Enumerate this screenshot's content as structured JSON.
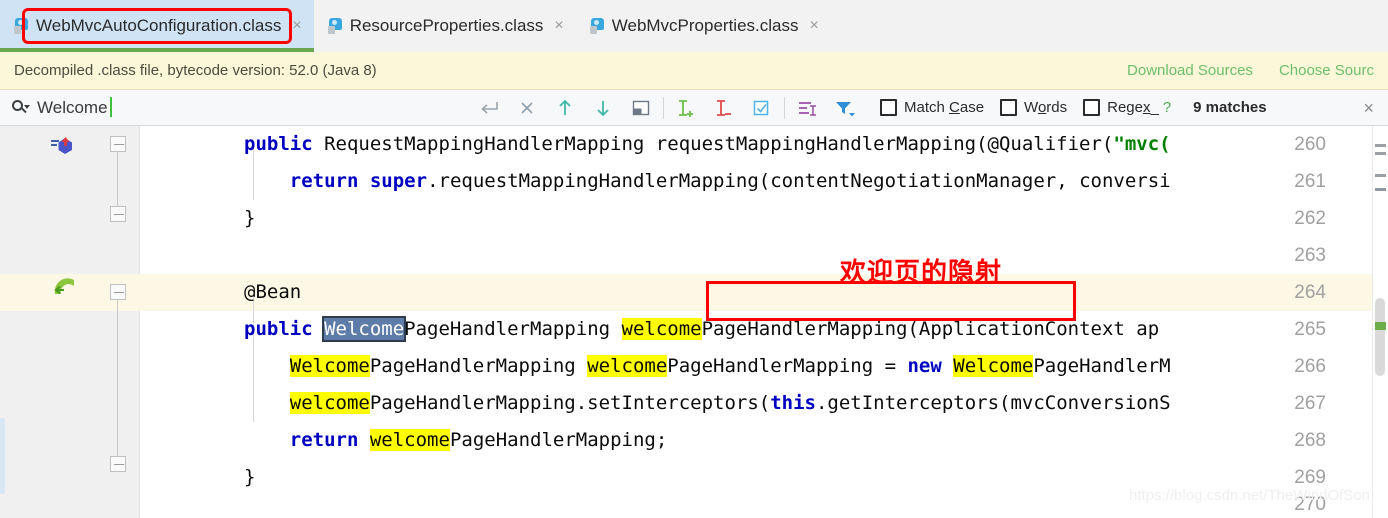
{
  "window": {
    "accent_green": "#6aa84f",
    "highlight_red": "#ff0000",
    "tab_active_bg": "#cfe3f5",
    "search_match_bg": "#ffff00"
  },
  "tabs": [
    {
      "label": "WebMvcAutoConfiguration.class",
      "icon": "java-class-icon",
      "close": "×",
      "active": true
    },
    {
      "label": "ResourceProperties.class",
      "icon": "java-class-icon",
      "close": "×",
      "active": false
    },
    {
      "label": "WebMvcProperties.class",
      "icon": "java-class-icon",
      "close": "×",
      "active": false
    }
  ],
  "notification": {
    "message": "Decompiled .class file, bytecode version: 52.0 (Java 8)",
    "download_sources": "Download Sources",
    "choose_sources": "Choose Sourc"
  },
  "search": {
    "icon": "search-icon",
    "value": "Welcome",
    "placeholder": "Search",
    "buttons": [
      {
        "name": "enter-icon",
        "glyph": "↩"
      },
      {
        "name": "clear-icon",
        "glyph": "×"
      },
      {
        "name": "find-previous-icon",
        "glyph": "↑"
      },
      {
        "name": "find-next-icon",
        "glyph": "↓"
      },
      {
        "name": "select-in-editor-icon",
        "glyph": "▣"
      },
      {
        "name": "add-occurrence-icon",
        "glyph": "I+"
      },
      {
        "name": "remove-occurrence-icon",
        "glyph": "I-"
      },
      {
        "name": "select-all-occurrences-icon",
        "glyph": "☑"
      },
      {
        "name": "find-in-selection-icon",
        "glyph": "≡I"
      },
      {
        "name": "filter-icon",
        "glyph": "▼"
      }
    ],
    "options": [
      {
        "name": "match-case-checkbox",
        "label_pre": "Match ",
        "label_underline": "C",
        "label_post": "ase",
        "checked": false
      },
      {
        "name": "words-checkbox",
        "label_pre": "W",
        "label_underline": "o",
        "label_post": "rds",
        "checked": false
      },
      {
        "name": "regex-checkbox",
        "label_pre": "Rege",
        "label_underline": "x",
        "label_post": "_",
        "checked": false
      }
    ],
    "help": "?",
    "match_count": "9 matches",
    "close": "×"
  },
  "editor": {
    "annotation": "欢迎页的隐射",
    "lines": [
      {
        "number": "260",
        "gutter_icon": "method-override-icon",
        "current": false,
        "indent": 0,
        "tokens": [
          {
            "t": "public",
            "c": "kw"
          },
          {
            "t": " RequestMappingHandlerMapping requestMappingHandlerMapping(@Qualifier(",
            "c": ""
          },
          {
            "t": "\"mvc(",
            "c": "str"
          }
        ]
      },
      {
        "number": "261",
        "gutter_icon": "",
        "current": false,
        "indent": 1,
        "tokens": [
          {
            "t": "    ",
            "c": ""
          },
          {
            "t": "return",
            "c": "kw"
          },
          {
            "t": " ",
            "c": ""
          },
          {
            "t": "super",
            "c": "kw"
          },
          {
            "t": ".requestMappingHandlerMapping(contentNegotiationManager, conversi",
            "c": ""
          }
        ]
      },
      {
        "number": "262",
        "gutter_icon": "",
        "current": false,
        "indent": 0,
        "tokens": [
          {
            "t": "}",
            "c": ""
          }
        ]
      },
      {
        "number": "263",
        "gutter_icon": "",
        "current": false,
        "indent": 0,
        "tokens": []
      },
      {
        "number": "264",
        "gutter_icon": "bean-icon",
        "current": false,
        "indent": 0,
        "tokens": [
          {
            "t": "@Bean",
            "c": ""
          }
        ]
      },
      {
        "number": "265",
        "gutter_icon": "",
        "current": true,
        "indent": 0,
        "tokens": [
          {
            "t": "public",
            "c": "kw"
          },
          {
            "t": " ",
            "c": ""
          },
          {
            "t": "Welcome",
            "c": "selhl"
          },
          {
            "t": "PageHandlerMapping ",
            "c": ""
          },
          {
            "t": "welcome",
            "c": "hl"
          },
          {
            "t": "PageHandlerMapping(ApplicationContext ap",
            "c": ""
          }
        ]
      },
      {
        "number": "266",
        "gutter_icon": "",
        "current": false,
        "indent": 1,
        "tokens": [
          {
            "t": "    ",
            "c": ""
          },
          {
            "t": "Welcome",
            "c": "hl"
          },
          {
            "t": "PageHandlerMapping ",
            "c": ""
          },
          {
            "t": "welcome",
            "c": "hl"
          },
          {
            "t": "PageHandlerMapping = ",
            "c": ""
          },
          {
            "t": "new",
            "c": "kw"
          },
          {
            "t": " ",
            "c": ""
          },
          {
            "t": "Welcome",
            "c": "hl"
          },
          {
            "t": "PageHandlerM",
            "c": ""
          }
        ]
      },
      {
        "number": "267",
        "gutter_icon": "",
        "current": false,
        "indent": 1,
        "tokens": [
          {
            "t": "    ",
            "c": ""
          },
          {
            "t": "welcome",
            "c": "hl"
          },
          {
            "t": "PageHandlerMapping.setInterceptors(",
            "c": ""
          },
          {
            "t": "this",
            "c": "kw"
          },
          {
            "t": ".getInterceptors(mvcConversionS",
            "c": ""
          }
        ]
      },
      {
        "number": "268",
        "gutter_icon": "",
        "current": false,
        "indent": 1,
        "tokens": [
          {
            "t": "    ",
            "c": ""
          },
          {
            "t": "return",
            "c": "kw"
          },
          {
            "t": " ",
            "c": ""
          },
          {
            "t": "welcome",
            "c": "hl"
          },
          {
            "t": "PageHandlerMapping;",
            "c": ""
          }
        ]
      },
      {
        "number": "269",
        "gutter_icon": "",
        "current": false,
        "indent": 0,
        "tokens": [
          {
            "t": "}",
            "c": ""
          }
        ]
      },
      {
        "number": "270",
        "gutter_icon": "",
        "current": false,
        "indent": 0,
        "tokens": []
      }
    ]
  },
  "watermark": "https://blog.csdn.net/TheWindOfSon"
}
